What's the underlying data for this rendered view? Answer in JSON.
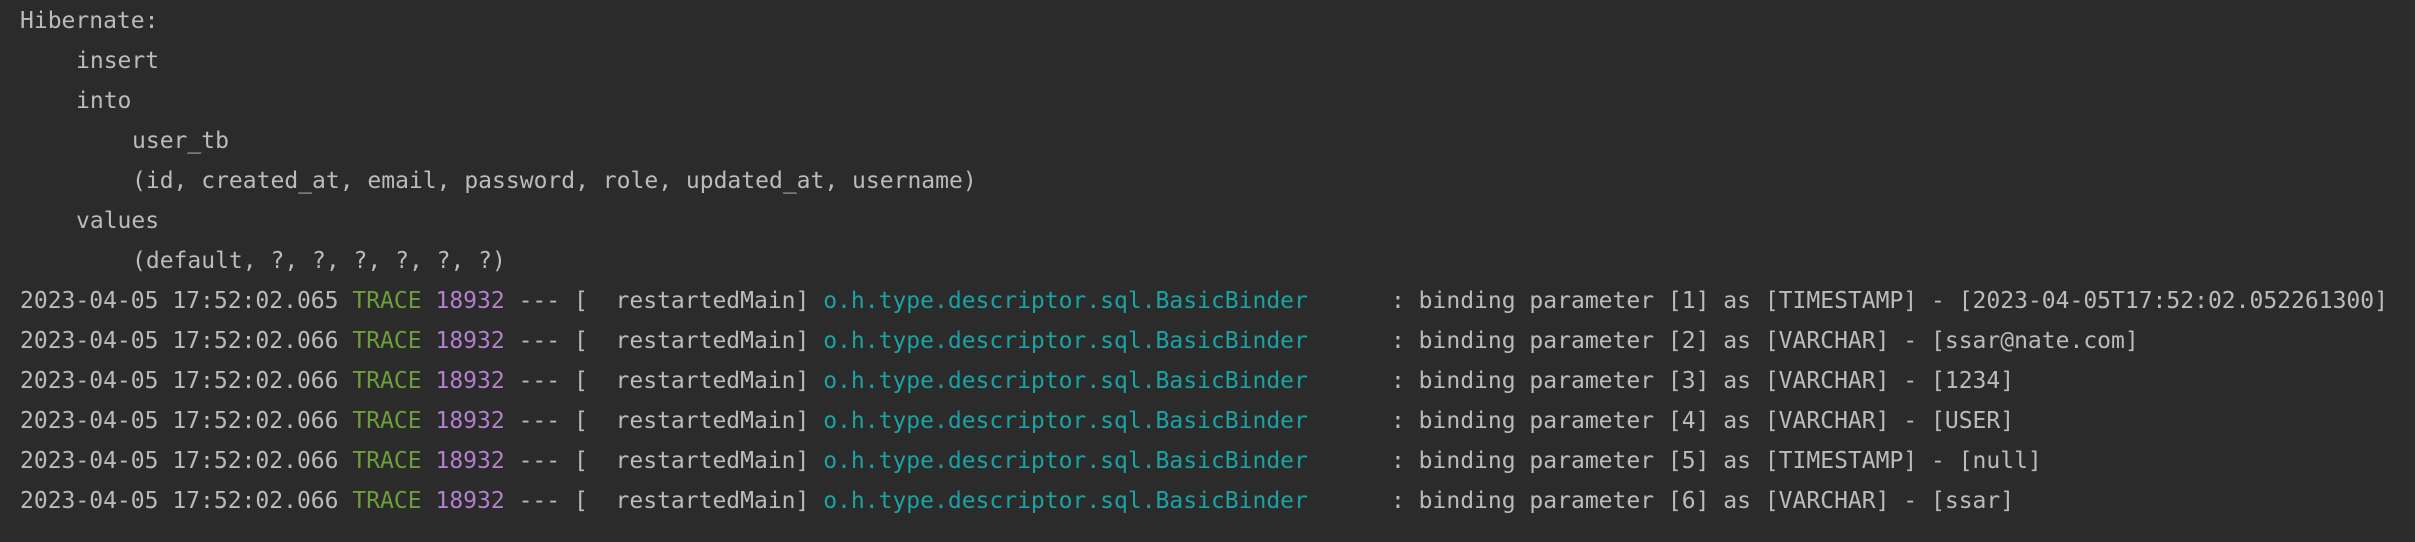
{
  "sql": {
    "header": "Hibernate:",
    "lines": [
      {
        "indent": 1,
        "text": "insert"
      },
      {
        "indent": 1,
        "text": "into"
      },
      {
        "indent": 2,
        "text": "user_tb"
      },
      {
        "indent": 2,
        "text": "(id, created_at, email, password, role, updated_at, username)"
      },
      {
        "indent": 1,
        "text": "values"
      },
      {
        "indent": 2,
        "text": "(default, ?, ?, ?, ?, ?, ?)"
      }
    ]
  },
  "log": {
    "level": "TRACE",
    "pid": "18932",
    "separator": " --- ",
    "thread": "[  restartedMain] ",
    "logger": "o.h.type.descriptor.sql.BasicBinder",
    "message_prefix": "      : ",
    "entries": [
      {
        "time": "2023-04-05 17:52:02.065",
        "message": "binding parameter [1] as [TIMESTAMP] - [2023-04-05T17:52:02.052261300]"
      },
      {
        "time": "2023-04-05 17:52:02.066",
        "message": "binding parameter [2] as [VARCHAR] - [ssar@nate.com]"
      },
      {
        "time": "2023-04-05 17:52:02.066",
        "message": "binding parameter [3] as [VARCHAR] - [1234]"
      },
      {
        "time": "2023-04-05 17:52:02.066",
        "message": "binding parameter [4] as [VARCHAR] - [USER]"
      },
      {
        "time": "2023-04-05 17:52:02.066",
        "message": "binding parameter [5] as [TIMESTAMP] - [null]"
      },
      {
        "time": "2023-04-05 17:52:02.066",
        "message": "binding parameter [6] as [VARCHAR] - [ssar]"
      }
    ]
  },
  "colors": {
    "background": "#2b2b2b",
    "text": "#bbbbbb",
    "trace": "#6a9f3b",
    "pid": "#b57fd0",
    "logger": "#1aa3a3"
  }
}
